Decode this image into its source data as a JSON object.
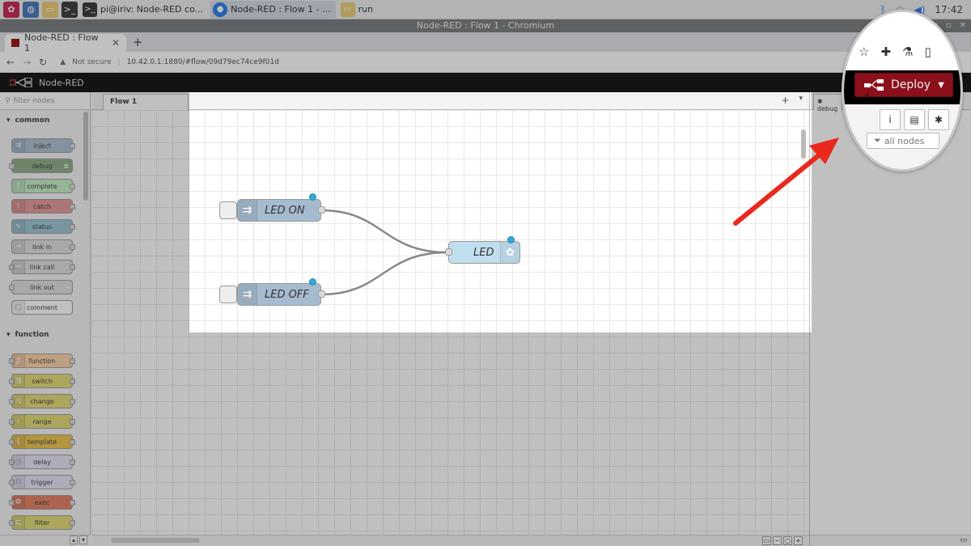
{
  "taskbar": {
    "tasks": [
      {
        "label": "pi@iriv: Node-RED co...",
        "active": false
      },
      {
        "label": "Node-RED : Flow 1 - ...",
        "active": true
      },
      {
        "label": "run",
        "active": false
      }
    ],
    "clock": "17:42"
  },
  "browser": {
    "window_title": "Node-RED : Flow 1 - Chromium",
    "tab_title": "Node-RED : Flow 1",
    "security_label": "Not secure",
    "url": "10.42.0.1:1880/#flow/09d79ec74ce9f01d"
  },
  "nodered": {
    "brand": "Node-RED",
    "filter_placeholder": "filter nodes",
    "categories": [
      {
        "name": "common",
        "nodes": [
          "inject",
          "debug",
          "complete",
          "catch",
          "status",
          "link in",
          "link call",
          "link out",
          "comment"
        ]
      },
      {
        "name": "function",
        "nodes": [
          "function",
          "switch",
          "change",
          "range",
          "template",
          "delay",
          "trigger",
          "exec",
          "filter"
        ]
      }
    ],
    "workspace_tab": "Flow 1",
    "flow_nodes": [
      {
        "label": "LED ON",
        "type": "inject"
      },
      {
        "label": "LED OFF",
        "type": "inject"
      },
      {
        "label": "LED",
        "type": "rpi-gpio out"
      }
    ],
    "sidebar_tab": "debug",
    "deploy_label": "Deploy",
    "debug_filter": "all nodes"
  },
  "colors": {
    "inject": "#a6bbcf",
    "debug": "#87a980",
    "complete": "#c0edc0",
    "catch": "#e49191",
    "status": "#94c1d0",
    "link": "#dddddd",
    "comment": "#ffffff",
    "function": "#fdd0a2",
    "switch": "#e2d96e",
    "change": "#e2d96e",
    "range": "#e2d96e",
    "template": "#ebc03f",
    "delay": "#e6e0f8",
    "trigger": "#e6e0f8",
    "exec": "#e57659",
    "filter": "#e2d96e",
    "gpio": "#c0deed",
    "deploy": "#8c101c",
    "arrow": "#e8291c"
  },
  "icons": [
    "raspberry-menu-icon",
    "globe-icon",
    "folder-icon",
    "terminal-icon",
    "chromium-icon",
    "bluetooth-icon",
    "wifi-icon",
    "volume-icon",
    "star-icon",
    "extensions-icon",
    "lab-icon",
    "sidepanel-icon",
    "info-icon",
    "book-icon",
    "bug-icon",
    "funnel-icon"
  ]
}
